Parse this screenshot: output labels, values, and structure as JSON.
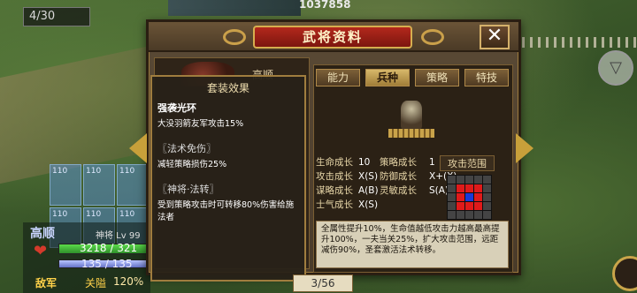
{
  "hud_top": {
    "counter": "4/30",
    "score": "1037858"
  },
  "map_tiles": [
    "110",
    "110",
    "110",
    "110",
    "110",
    "110"
  ],
  "dialog": {
    "title": "武将资料",
    "close_label": "✕",
    "hero_name": "高顺",
    "tabs": [
      {
        "label": "能力",
        "active": false
      },
      {
        "label": "兵种",
        "active": true
      },
      {
        "label": "策略",
        "active": false
      },
      {
        "label": "特技",
        "active": false
      }
    ],
    "set_effect": {
      "title": "套装效果",
      "items": [
        {
          "name": "强袭光环",
          "desc": "大没羽箭友军攻击15%"
        },
        {
          "name": "〖法术免伤〗",
          "desc": "减轻策略损伤25%"
        },
        {
          "name": "〖神将·法转〗",
          "desc": "受到策略攻击时可转移80%伤害给施法者"
        }
      ]
    },
    "stats": [
      {
        "label": "生命成长",
        "value": "10",
        "label2": "策略成长",
        "value2": "1"
      },
      {
        "label": "攻击成长",
        "value": "X(S)",
        "label2": "防御成长",
        "value2": "X+(X)"
      },
      {
        "label": "谋略成长",
        "value": "A(B)",
        "label2": "灵敏成长",
        "value2": "S(A)"
      },
      {
        "label": "士气成长",
        "value": "X(S)",
        "label2": "",
        "value2": ""
      }
    ],
    "attack_range_title": "攻击范围",
    "description": "全属性提升10%，生命值越低攻击力越高最高提升100%，一夫当关25%，扩大攻击范围，远距减伤90%，圣套激活法术转移。"
  },
  "pager": "3/56",
  "hero_hud": {
    "name": "高顺",
    "rank": "神将 Lv 99",
    "hp": "3218 / 321",
    "mp": "135 / 135",
    "hp_level": 1.0,
    "mp_level": 1.0,
    "side": "敌军",
    "pass": "关隘",
    "percent": "120%"
  },
  "colors": {
    "tab_active": "#d7b86a",
    "title_red": "#b3281c",
    "range_hit": "#e01a1a",
    "range_self": "#1a3ad8"
  },
  "icons": {
    "close": "close-icon",
    "prev": "arrow-left-icon",
    "next": "arrow-right-icon",
    "heart": "heart-icon"
  }
}
